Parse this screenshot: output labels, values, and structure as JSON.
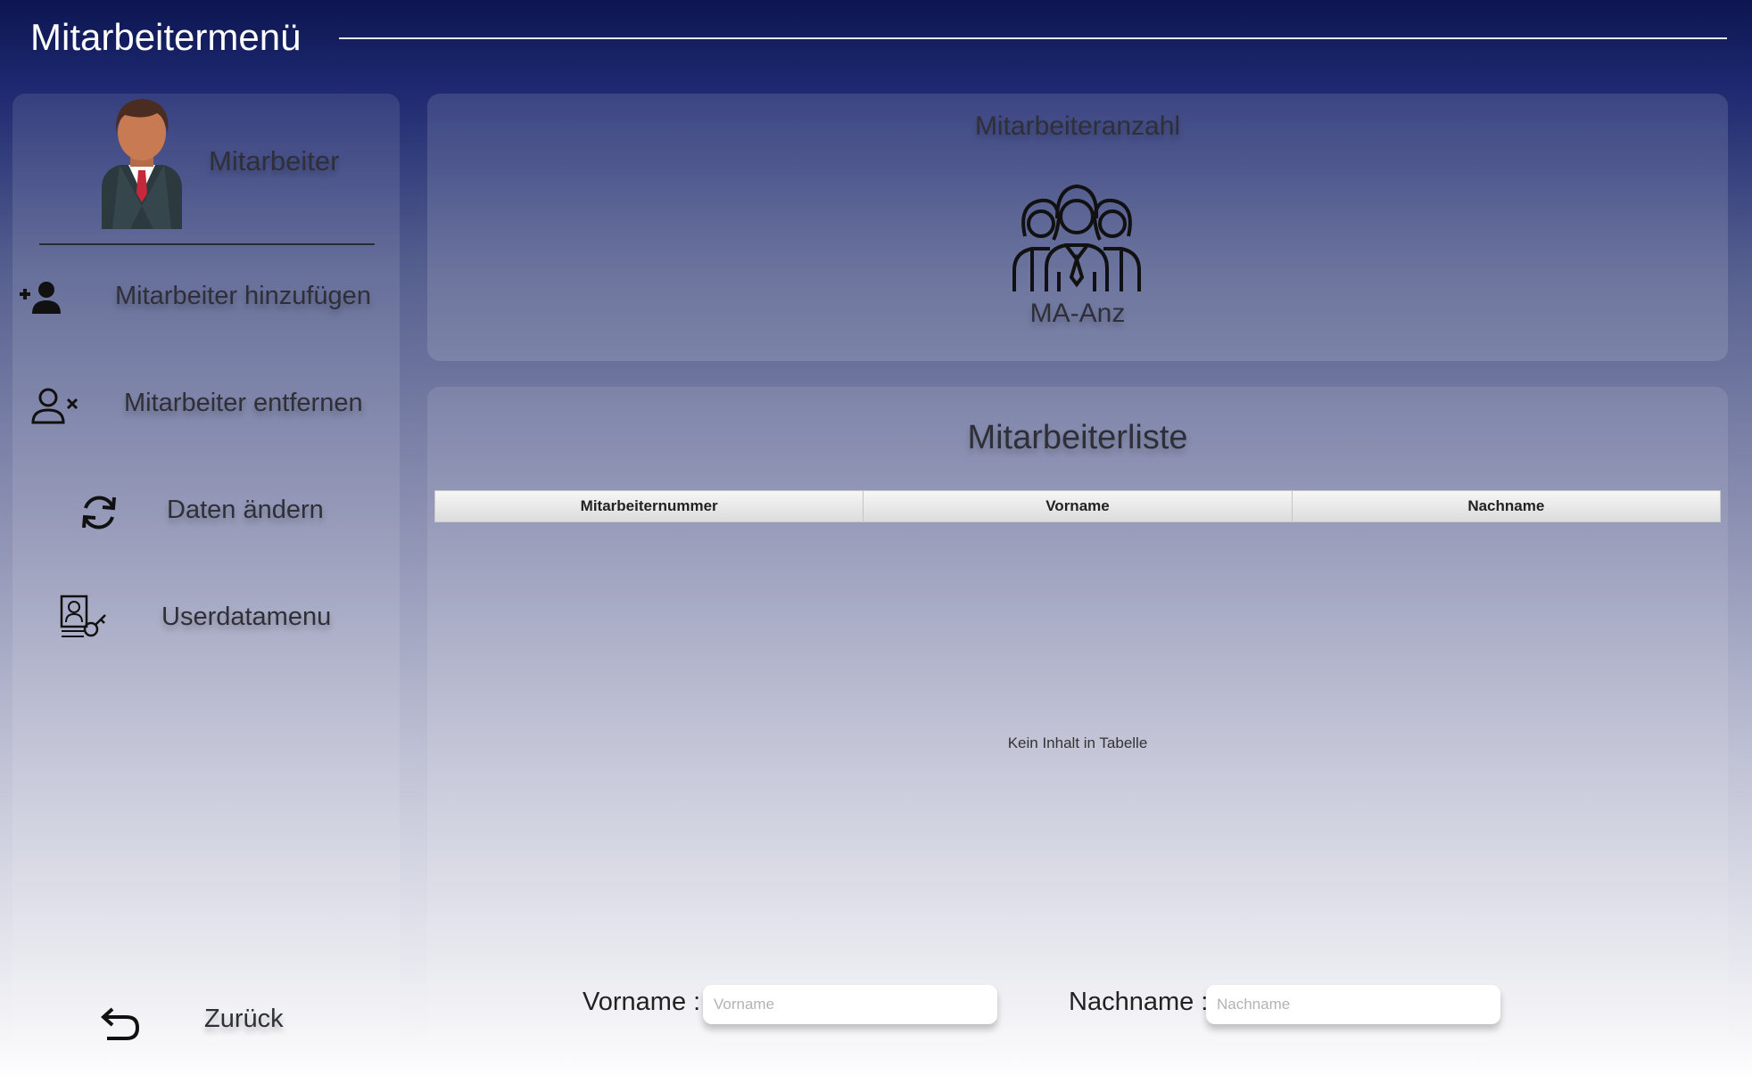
{
  "window": {
    "title": "Mitarbeitermenü"
  },
  "sidebar": {
    "user_label": "Mitarbeiter",
    "items": [
      {
        "label": "Mitarbeiter hinzufügen",
        "icon": "add-user-icon"
      },
      {
        "label": "Mitarbeiter entfernen",
        "icon": "remove-user-icon"
      },
      {
        "label": "Daten ändern",
        "icon": "refresh-icon"
      },
      {
        "label": "Userdatamenu",
        "icon": "user-key-icon"
      }
    ],
    "back_label": "Zurück"
  },
  "count_panel": {
    "title": "Mitarbeiteranzahl",
    "value": "MA-Anz"
  },
  "list_panel": {
    "title": "Mitarbeiterliste",
    "columns": [
      "Mitarbeiternummer",
      "Vorname",
      "Nachname"
    ],
    "rows": [],
    "empty_message": "Kein Inhalt in Tabelle"
  },
  "filters": {
    "vorname_label": "Vorname :",
    "vorname_placeholder": "Vorname",
    "nachname_label": "Nachname :",
    "nachname_placeholder": "Nachname"
  },
  "colors": {
    "header_dark": "#0d1650",
    "accent_tie": "#c62839",
    "skin": "#c87a52"
  }
}
